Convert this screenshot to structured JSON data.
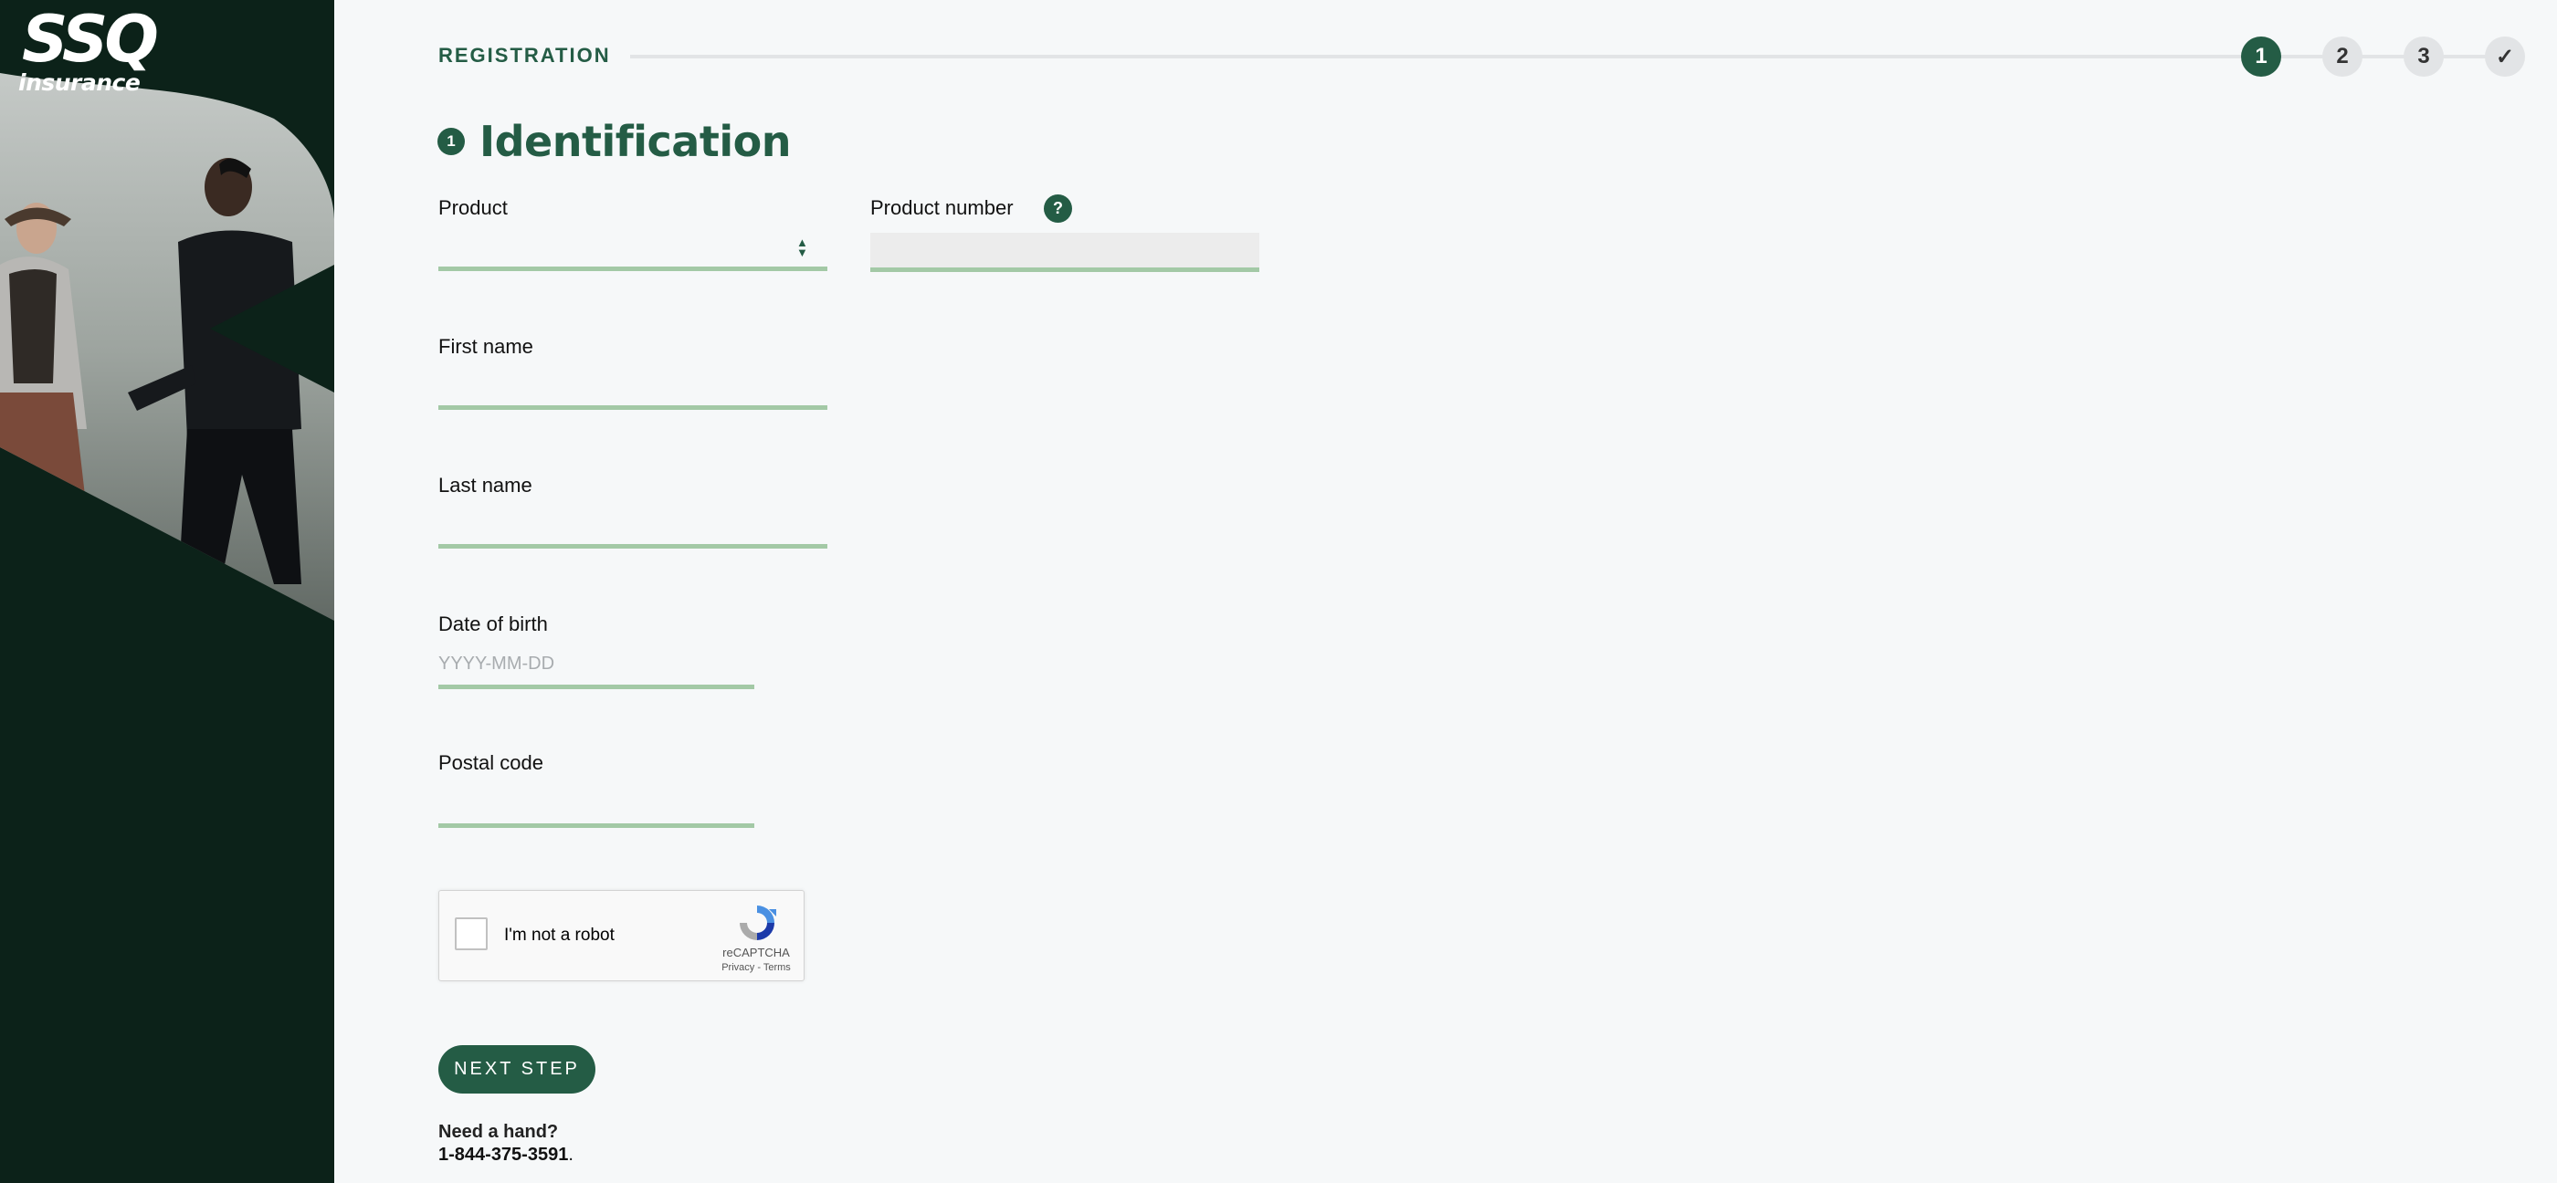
{
  "brand": {
    "logo_main": "SSQ",
    "logo_sub": "insurance"
  },
  "stepper": {
    "label": "REGISTRATION",
    "steps": [
      "1",
      "2",
      "3",
      "✓"
    ],
    "active_step": 1
  },
  "section": {
    "number": "1",
    "title": "Identification"
  },
  "form": {
    "product": {
      "label": "Product",
      "value": ""
    },
    "product_number": {
      "label": "Product number",
      "help": "?",
      "value": ""
    },
    "first_name": {
      "label": "First name",
      "value": ""
    },
    "last_name": {
      "label": "Last name",
      "value": ""
    },
    "date_of_birth": {
      "label": "Date of birth",
      "placeholder": "YYYY-MM-DD",
      "value": ""
    },
    "postal_code": {
      "label": "Postal code",
      "value": ""
    }
  },
  "captcha": {
    "label": "I'm not a robot",
    "brand": "reCAPTCHA",
    "links": "Privacy - Terms"
  },
  "next_button": "NEXT STEP",
  "help": {
    "question": "Need a hand?",
    "phone": "1-844-375-3591",
    "suffix": "."
  },
  "colors": {
    "primary": "#245c45",
    "sidebar": "#0c2219",
    "underline": "#a3c9a6",
    "background": "#f6f8f9"
  }
}
